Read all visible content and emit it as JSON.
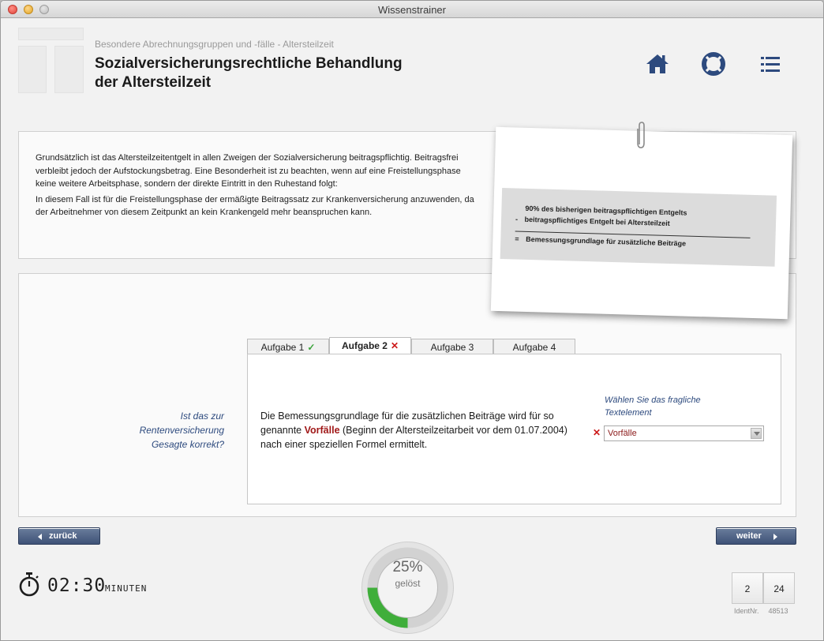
{
  "window": {
    "title": "Wissenstrainer"
  },
  "header": {
    "breadcrumb": "Besondere Abrechnungsgruppen und -fälle - Altersteilzeit",
    "title_line1": "Sozialversicherungsrechtliche Behandlung",
    "title_line2": "der Altersteilzeit",
    "icons": [
      "home-icon",
      "help-lifebuoy-icon",
      "list-menu-icon"
    ]
  },
  "info": {
    "paragraph1": "Grundsätzlich ist das Altersteilzeitentgelt in allen Zweigen der Sozialversicherung beitragspflichtig. Beitragsfrei verbleibt jedoch der Aufstockungsbetrag. Eine Besonderheit ist zu beachten, wenn auf eine Freistellungsphase keine weitere Arbeitsphase, sondern der direkte Eintritt in den Ruhestand folgt:",
    "paragraph2": "In diesem Fall ist für die Freistellungsphase der ermäßigte Beitragssatz zur Krankenversicherung anzuwenden, da der Arbeitnehmer von diesem Zeitpunkt an kein Krankengeld mehr beanspruchen kann."
  },
  "note": {
    "line1": "90% des bisherigen beitragspflichtigen Entgelts",
    "line2_symbol": "-",
    "line2": "beitragspflichtiges Entgelt bei Altersteilzeit",
    "line3_symbol": "=",
    "line3": "Bemessungsgrundlage für zusätzliche Beiträge"
  },
  "question": {
    "line1": "Ist das zur",
    "line2": "Rentenversicherung",
    "line3": "Gesagte korrekt?"
  },
  "tabs": [
    {
      "label": "Aufgabe 1",
      "mark": "✓"
    },
    {
      "label": "Aufgabe 2",
      "mark": "✕"
    },
    {
      "label": "Aufgabe 3",
      "mark": ""
    },
    {
      "label": "Aufgabe 4",
      "mark": ""
    }
  ],
  "task": {
    "text_before": "Die Bemessungsgrundlage für die zusätzlichen Beiträge wird für so genannte ",
    "highlight": "Vorfälle",
    "text_after": " (Beginn der Altersteilzeitarbeit vor dem 01.07.2004) nach einer speziellen Formel ermittelt.",
    "select_label_line1": "Wählen Sie das fragliche",
    "select_label_line2": "Textelement",
    "select_mark": "✕",
    "select_value": "Vorfälle"
  },
  "nav": {
    "back_label": "zurück",
    "next_label": "weiter"
  },
  "progress": {
    "percent_text": "25%",
    "label": "gelöst",
    "fraction": 0.25
  },
  "timer": {
    "value": "02:30",
    "unit": "MINUTEN"
  },
  "pagination": {
    "current": "2",
    "total": "24"
  },
  "ident": {
    "label": "IdentNr.",
    "number": "48513"
  },
  "colors": {
    "accent_navy": "#2d4a7e",
    "success_green": "#3aa33a",
    "error_red": "#cc1a1a",
    "highlight_red": "#a01818"
  }
}
